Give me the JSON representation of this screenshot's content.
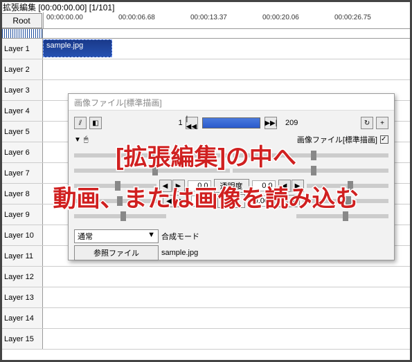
{
  "title": "拡張編集 [00:00:00.00] [1/101]",
  "root_label": "Root",
  "ruler_ticks": [
    {
      "pos": 4,
      "text": "00:00:00.00"
    },
    {
      "pos": 108,
      "text": "00:00:06.68"
    },
    {
      "pos": 212,
      "text": "00:00:13.37"
    },
    {
      "pos": 316,
      "text": "00:00:20.06"
    },
    {
      "pos": 420,
      "text": "00:00:26.75"
    }
  ],
  "layers": [
    "Layer 1",
    "Layer 2",
    "Layer 3",
    "Layer 4",
    "Layer 5",
    "Layer 6",
    "Layer 7",
    "Layer 8",
    "Layer 9",
    "Layer 10",
    "Layer 11",
    "Layer 12",
    "Layer 13",
    "Layer 14",
    "Layer 15"
  ],
  "clip_name": "sample.jpg",
  "dialog": {
    "title": "画像ファイル[標準描画]",
    "frame_start": "1",
    "frame_end": "209",
    "header_right": "画像ファイル[標準描画]",
    "tri_down": "▼",
    "rows": [
      {
        "val_l": "0.0",
        "label": "透明度",
        "val_r": "0.0"
      },
      {
        "val_l": "0.00",
        "label": "回転",
        "val_r": "0.00"
      }
    ],
    "blend_label": "合成モード",
    "blend_value": "通常",
    "ref_label": "参照ファイル",
    "ref_value": "sample.jpg"
  },
  "overlay": {
    "line1": "[拡張編集]の中へ",
    "line2": "動画、または画像を読み込む"
  },
  "icons": {
    "seek_first": "|◀◀",
    "seek_last": "▶▶|",
    "loop": "↻",
    "plus": "+",
    "left": "◀",
    "right": "▶",
    "dd": "▼"
  }
}
